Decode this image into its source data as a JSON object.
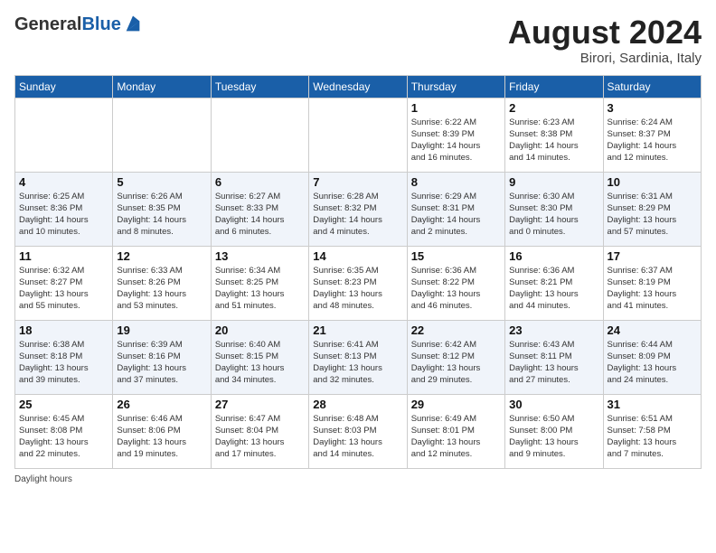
{
  "header": {
    "logo_general": "General",
    "logo_blue": "Blue",
    "month_title": "August 2024",
    "location": "Birori, Sardinia, Italy"
  },
  "footer": {
    "daylight_hours": "Daylight hours"
  },
  "days_of_week": [
    "Sunday",
    "Monday",
    "Tuesday",
    "Wednesday",
    "Thursday",
    "Friday",
    "Saturday"
  ],
  "weeks": [
    [
      {
        "day": "",
        "info": ""
      },
      {
        "day": "",
        "info": ""
      },
      {
        "day": "",
        "info": ""
      },
      {
        "day": "",
        "info": ""
      },
      {
        "day": "1",
        "info": "Sunrise: 6:22 AM\nSunset: 8:39 PM\nDaylight: 14 hours\nand 16 minutes."
      },
      {
        "day": "2",
        "info": "Sunrise: 6:23 AM\nSunset: 8:38 PM\nDaylight: 14 hours\nand 14 minutes."
      },
      {
        "day": "3",
        "info": "Sunrise: 6:24 AM\nSunset: 8:37 PM\nDaylight: 14 hours\nand 12 minutes."
      }
    ],
    [
      {
        "day": "4",
        "info": "Sunrise: 6:25 AM\nSunset: 8:36 PM\nDaylight: 14 hours\nand 10 minutes."
      },
      {
        "day": "5",
        "info": "Sunrise: 6:26 AM\nSunset: 8:35 PM\nDaylight: 14 hours\nand 8 minutes."
      },
      {
        "day": "6",
        "info": "Sunrise: 6:27 AM\nSunset: 8:33 PM\nDaylight: 14 hours\nand 6 minutes."
      },
      {
        "day": "7",
        "info": "Sunrise: 6:28 AM\nSunset: 8:32 PM\nDaylight: 14 hours\nand 4 minutes."
      },
      {
        "day": "8",
        "info": "Sunrise: 6:29 AM\nSunset: 8:31 PM\nDaylight: 14 hours\nand 2 minutes."
      },
      {
        "day": "9",
        "info": "Sunrise: 6:30 AM\nSunset: 8:30 PM\nDaylight: 14 hours\nand 0 minutes."
      },
      {
        "day": "10",
        "info": "Sunrise: 6:31 AM\nSunset: 8:29 PM\nDaylight: 13 hours\nand 57 minutes."
      }
    ],
    [
      {
        "day": "11",
        "info": "Sunrise: 6:32 AM\nSunset: 8:27 PM\nDaylight: 13 hours\nand 55 minutes."
      },
      {
        "day": "12",
        "info": "Sunrise: 6:33 AM\nSunset: 8:26 PM\nDaylight: 13 hours\nand 53 minutes."
      },
      {
        "day": "13",
        "info": "Sunrise: 6:34 AM\nSunset: 8:25 PM\nDaylight: 13 hours\nand 51 minutes."
      },
      {
        "day": "14",
        "info": "Sunrise: 6:35 AM\nSunset: 8:23 PM\nDaylight: 13 hours\nand 48 minutes."
      },
      {
        "day": "15",
        "info": "Sunrise: 6:36 AM\nSunset: 8:22 PM\nDaylight: 13 hours\nand 46 minutes."
      },
      {
        "day": "16",
        "info": "Sunrise: 6:36 AM\nSunset: 8:21 PM\nDaylight: 13 hours\nand 44 minutes."
      },
      {
        "day": "17",
        "info": "Sunrise: 6:37 AM\nSunset: 8:19 PM\nDaylight: 13 hours\nand 41 minutes."
      }
    ],
    [
      {
        "day": "18",
        "info": "Sunrise: 6:38 AM\nSunset: 8:18 PM\nDaylight: 13 hours\nand 39 minutes."
      },
      {
        "day": "19",
        "info": "Sunrise: 6:39 AM\nSunset: 8:16 PM\nDaylight: 13 hours\nand 37 minutes."
      },
      {
        "day": "20",
        "info": "Sunrise: 6:40 AM\nSunset: 8:15 PM\nDaylight: 13 hours\nand 34 minutes."
      },
      {
        "day": "21",
        "info": "Sunrise: 6:41 AM\nSunset: 8:13 PM\nDaylight: 13 hours\nand 32 minutes."
      },
      {
        "day": "22",
        "info": "Sunrise: 6:42 AM\nSunset: 8:12 PM\nDaylight: 13 hours\nand 29 minutes."
      },
      {
        "day": "23",
        "info": "Sunrise: 6:43 AM\nSunset: 8:11 PM\nDaylight: 13 hours\nand 27 minutes."
      },
      {
        "day": "24",
        "info": "Sunrise: 6:44 AM\nSunset: 8:09 PM\nDaylight: 13 hours\nand 24 minutes."
      }
    ],
    [
      {
        "day": "25",
        "info": "Sunrise: 6:45 AM\nSunset: 8:08 PM\nDaylight: 13 hours\nand 22 minutes."
      },
      {
        "day": "26",
        "info": "Sunrise: 6:46 AM\nSunset: 8:06 PM\nDaylight: 13 hours\nand 19 minutes."
      },
      {
        "day": "27",
        "info": "Sunrise: 6:47 AM\nSunset: 8:04 PM\nDaylight: 13 hours\nand 17 minutes."
      },
      {
        "day": "28",
        "info": "Sunrise: 6:48 AM\nSunset: 8:03 PM\nDaylight: 13 hours\nand 14 minutes."
      },
      {
        "day": "29",
        "info": "Sunrise: 6:49 AM\nSunset: 8:01 PM\nDaylight: 13 hours\nand 12 minutes."
      },
      {
        "day": "30",
        "info": "Sunrise: 6:50 AM\nSunset: 8:00 PM\nDaylight: 13 hours\nand 9 minutes."
      },
      {
        "day": "31",
        "info": "Sunrise: 6:51 AM\nSunset: 7:58 PM\nDaylight: 13 hours\nand 7 minutes."
      }
    ]
  ]
}
